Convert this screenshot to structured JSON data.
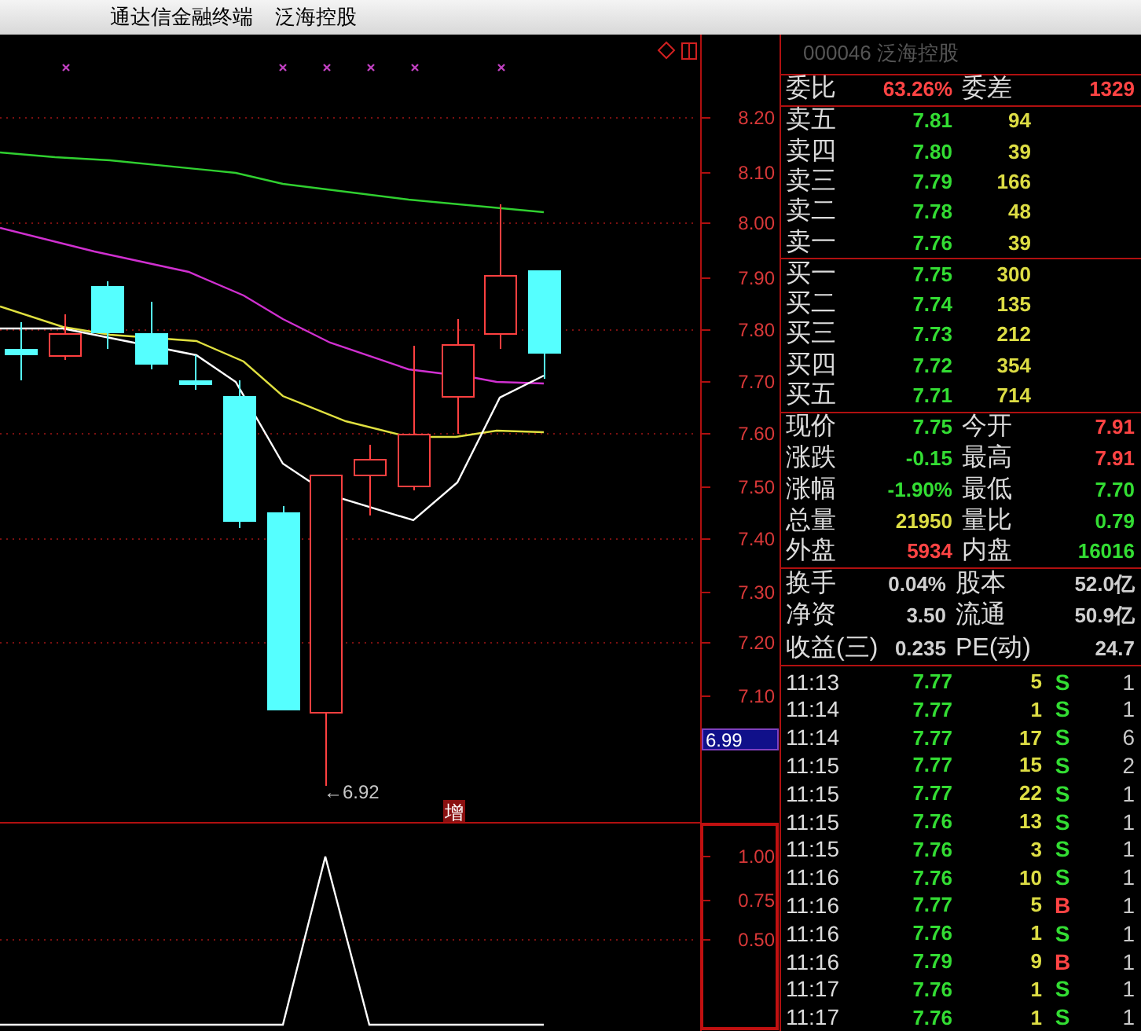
{
  "window": {
    "title": "通达信金融终端",
    "stock_name": "泛海控股"
  },
  "chart": {
    "price_axis": [
      "8.20",
      "8.10",
      "8.00",
      "7.90",
      "7.80",
      "7.70",
      "7.60",
      "7.50",
      "7.40",
      "7.30",
      "7.20",
      "7.10"
    ],
    "current_price_tag": "6.99",
    "low_label": "←6.92",
    "event_tag": "增",
    "indicator_axis": [
      "1.00",
      "0.75",
      "0.50"
    ]
  },
  "quote": {
    "header": "000046 泛海控股",
    "ratio": {
      "label": "委比",
      "value": "63.26%",
      "label2": "委差",
      "value2": "1329"
    },
    "asks": [
      {
        "label": "卖五",
        "price": "7.81",
        "volume": "94"
      },
      {
        "label": "卖四",
        "price": "7.80",
        "volume": "39"
      },
      {
        "label": "卖三",
        "price": "7.79",
        "volume": "166"
      },
      {
        "label": "卖二",
        "price": "7.78",
        "volume": "48"
      },
      {
        "label": "卖一",
        "price": "7.76",
        "volume": "39"
      }
    ],
    "bids": [
      {
        "label": "买一",
        "price": "7.75",
        "volume": "300"
      },
      {
        "label": "买二",
        "price": "7.74",
        "volume": "135"
      },
      {
        "label": "买三",
        "price": "7.73",
        "volume": "212"
      },
      {
        "label": "买四",
        "price": "7.72",
        "volume": "354"
      },
      {
        "label": "买五",
        "price": "7.71",
        "volume": "714"
      }
    ],
    "stats": [
      {
        "label": "现价",
        "value": "7.75",
        "color": "#33dd33"
      },
      {
        "label": "今开",
        "value": "7.91",
        "color": "#ff4444"
      },
      {
        "label": "涨跌",
        "value": "-0.15",
        "color": "#33dd33"
      },
      {
        "label": "最高",
        "value": "7.91",
        "color": "#ff4444"
      },
      {
        "label": "涨幅",
        "value": "-1.90%",
        "color": "#33dd33"
      },
      {
        "label": "最低",
        "value": "7.70",
        "color": "#33dd33"
      },
      {
        "label": "总量",
        "value": "21950",
        "color": "#dddd44"
      },
      {
        "label": "量比",
        "value": "0.79",
        "color": "#33dd33"
      },
      {
        "label": "外盘",
        "value": "5934",
        "color": "#ff4444"
      },
      {
        "label": "内盘",
        "value": "16016",
        "color": "#33dd33"
      }
    ],
    "fundamentals": [
      {
        "label": "换手",
        "value": "0.04%",
        "label2": "股本",
        "value2": "52.0亿"
      },
      {
        "label": "净资",
        "value": "3.50",
        "label2": "流通",
        "value2": "50.9亿"
      },
      {
        "label": "收益(三)",
        "value": "0.235",
        "label2": "PE(动)",
        "value2": "24.7"
      }
    ],
    "ticks": [
      {
        "time": "11:13",
        "price": "7.77",
        "volume": "5",
        "side": "S",
        "count": "1"
      },
      {
        "time": "11:14",
        "price": "7.77",
        "volume": "1",
        "side": "S",
        "count": "1"
      },
      {
        "time": "11:14",
        "price": "7.77",
        "volume": "17",
        "side": "S",
        "count": "6"
      },
      {
        "time": "11:15",
        "price": "7.77",
        "volume": "15",
        "side": "S",
        "count": "2"
      },
      {
        "time": "11:15",
        "price": "7.77",
        "volume": "22",
        "side": "S",
        "count": "1"
      },
      {
        "time": "11:15",
        "price": "7.76",
        "volume": "13",
        "side": "S",
        "count": "1"
      },
      {
        "time": "11:15",
        "price": "7.76",
        "volume": "3",
        "side": "S",
        "count": "1"
      },
      {
        "time": "11:16",
        "price": "7.76",
        "volume": "10",
        "side": "S",
        "count": "1"
      },
      {
        "time": "11:16",
        "price": "7.77",
        "volume": "5",
        "side": "B",
        "count": "1"
      },
      {
        "time": "11:16",
        "price": "7.76",
        "volume": "1",
        "side": "S",
        "count": "1"
      },
      {
        "time": "11:16",
        "price": "7.79",
        "volume": "9",
        "side": "B",
        "count": "1"
      },
      {
        "time": "11:17",
        "price": "7.76",
        "volume": "1",
        "side": "S",
        "count": "1"
      },
      {
        "time": "11:17",
        "price": "7.76",
        "volume": "1",
        "side": "S",
        "count": "1"
      }
    ]
  }
}
